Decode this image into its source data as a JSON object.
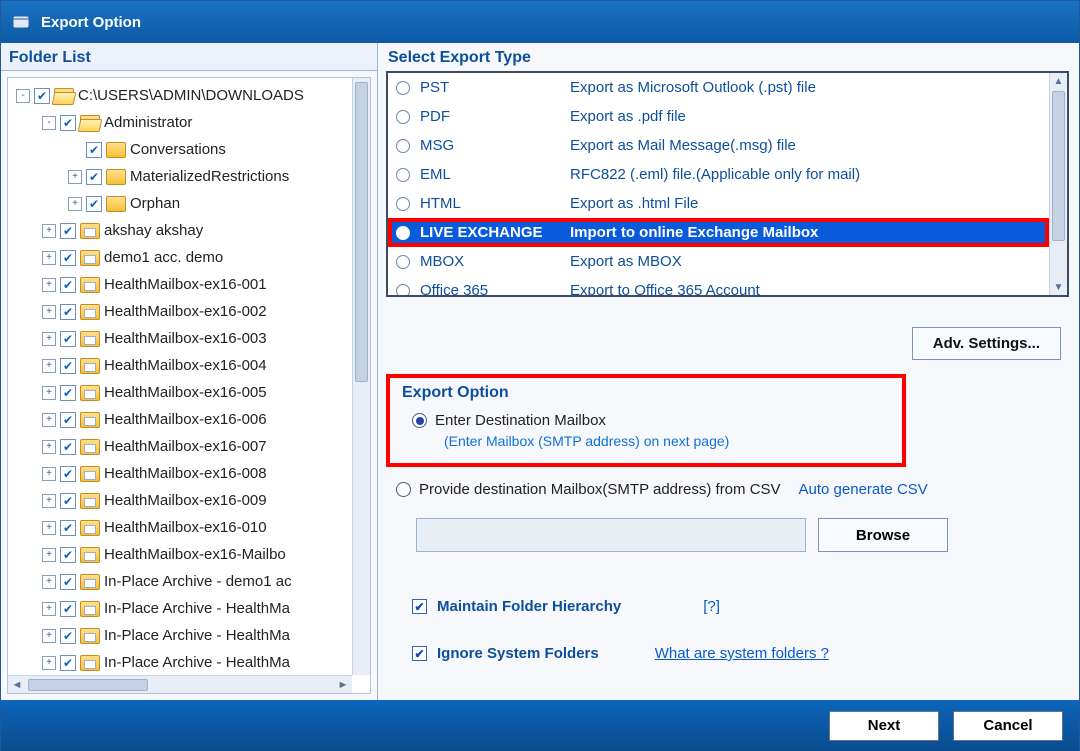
{
  "titlebar": {
    "title": "Export Option"
  },
  "folder_pane_title": "Folder List",
  "tree": [
    {
      "indent": 0,
      "toggle": "-",
      "check": true,
      "folder": "open",
      "label": "C:\\USERS\\ADMIN\\DOWNLOADS"
    },
    {
      "indent": 1,
      "toggle": "-",
      "check": true,
      "folder": "open",
      "label": "Administrator"
    },
    {
      "indent": 2,
      "toggle": "",
      "check": true,
      "folder": "closed",
      "label": "Conversations"
    },
    {
      "indent": 2,
      "toggle": "+",
      "check": true,
      "folder": "closed",
      "label": "MaterializedRestrictions"
    },
    {
      "indent": 2,
      "toggle": "+",
      "check": true,
      "folder": "closed",
      "label": "Orphan"
    },
    {
      "indent": 1,
      "toggle": "+",
      "check": true,
      "folder": "mail",
      "label": "akshay akshay"
    },
    {
      "indent": 1,
      "toggle": "+",
      "check": true,
      "folder": "mail",
      "label": "demo1 acc. demo"
    },
    {
      "indent": 1,
      "toggle": "+",
      "check": true,
      "folder": "mail",
      "label": "HealthMailbox-ex16-001"
    },
    {
      "indent": 1,
      "toggle": "+",
      "check": true,
      "folder": "mail",
      "label": "HealthMailbox-ex16-002"
    },
    {
      "indent": 1,
      "toggle": "+",
      "check": true,
      "folder": "mail",
      "label": "HealthMailbox-ex16-003"
    },
    {
      "indent": 1,
      "toggle": "+",
      "check": true,
      "folder": "mail",
      "label": "HealthMailbox-ex16-004"
    },
    {
      "indent": 1,
      "toggle": "+",
      "check": true,
      "folder": "mail",
      "label": "HealthMailbox-ex16-005"
    },
    {
      "indent": 1,
      "toggle": "+",
      "check": true,
      "folder": "mail",
      "label": "HealthMailbox-ex16-006"
    },
    {
      "indent": 1,
      "toggle": "+",
      "check": true,
      "folder": "mail",
      "label": "HealthMailbox-ex16-007"
    },
    {
      "indent": 1,
      "toggle": "+",
      "check": true,
      "folder": "mail",
      "label": "HealthMailbox-ex16-008"
    },
    {
      "indent": 1,
      "toggle": "+",
      "check": true,
      "folder": "mail",
      "label": "HealthMailbox-ex16-009"
    },
    {
      "indent": 1,
      "toggle": "+",
      "check": true,
      "folder": "mail",
      "label": "HealthMailbox-ex16-010"
    },
    {
      "indent": 1,
      "toggle": "+",
      "check": true,
      "folder": "mail",
      "label": "HealthMailbox-ex16-Mailbo"
    },
    {
      "indent": 1,
      "toggle": "+",
      "check": true,
      "folder": "mail",
      "label": "In-Place Archive - demo1 ac"
    },
    {
      "indent": 1,
      "toggle": "+",
      "check": true,
      "folder": "mail",
      "label": "In-Place Archive - HealthMa"
    },
    {
      "indent": 1,
      "toggle": "+",
      "check": true,
      "folder": "mail",
      "label": "In-Place Archive - HealthMa"
    },
    {
      "indent": 1,
      "toggle": "+",
      "check": true,
      "folder": "mail",
      "label": "In-Place Archive - HealthMa"
    }
  ],
  "export_pane_title": "Select Export Type",
  "export_types": [
    {
      "name": "PST",
      "desc": "Export as Microsoft Outlook (.pst) file",
      "selected": false
    },
    {
      "name": "PDF",
      "desc": "Export as .pdf file",
      "selected": false
    },
    {
      "name": "MSG",
      "desc": "Export as Mail Message(.msg) file",
      "selected": false
    },
    {
      "name": "EML",
      "desc": "RFC822 (.eml) file.(Applicable only for mail)",
      "selected": false
    },
    {
      "name": "HTML",
      "desc": "Export as .html File",
      "selected": false
    },
    {
      "name": "LIVE EXCHANGE",
      "desc": "Import to online Exchange Mailbox",
      "selected": true,
      "highlight": true
    },
    {
      "name": "MBOX",
      "desc": "Export as MBOX",
      "selected": false
    },
    {
      "name": "Office 365",
      "desc": "Export to Office 365 Account",
      "selected": false
    }
  ],
  "adv_settings": "Adv. Settings...",
  "export_option": {
    "title": "Export Option",
    "enter_dest": "Enter Destination Mailbox",
    "enter_dest_hint": "(Enter Mailbox (SMTP address) on next page)",
    "csv_option": "Provide destination Mailbox(SMTP address) from CSV",
    "auto_gen": "Auto generate CSV",
    "browse": "Browse"
  },
  "maintain_hierarchy": "Maintain Folder Hierarchy",
  "help_q": "[?]",
  "ignore_system": "Ignore System Folders",
  "system_link": "What are system folders ?",
  "footer": {
    "next": "Next",
    "cancel": "Cancel"
  }
}
